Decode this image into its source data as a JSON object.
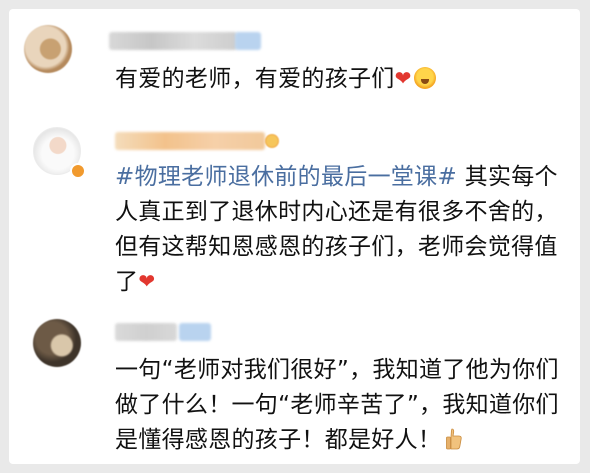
{
  "comments": [
    {
      "nickname": "",
      "text": "有爱的老师，有爱的孩子们",
      "icons": [
        "heart-icon",
        "emoji-icon"
      ]
    },
    {
      "nickname": "",
      "topic": "#物理老师退休前的最后一堂课#",
      "text_lines": [
        " 其实每个",
        "人真正到了退休时内心还是有很多不舍的，",
        "但有这帮知恩感恩的孩子们，老师会觉得值",
        "了"
      ],
      "icons": [
        "heart-icon"
      ]
    },
    {
      "nickname": "",
      "text_lines": [
        "一句“老师对我们很好”，我知道了他为你们",
        "做了什么！一句“老师辛苦了”，我知道你们",
        "是懂得感恩的孩子！都是好人！"
      ],
      "icons": [
        "thumbs-up-icon"
      ]
    }
  ],
  "colors": {
    "topic": "#4a6ea0",
    "heart": "#e2372f",
    "background": "#ffffff"
  }
}
